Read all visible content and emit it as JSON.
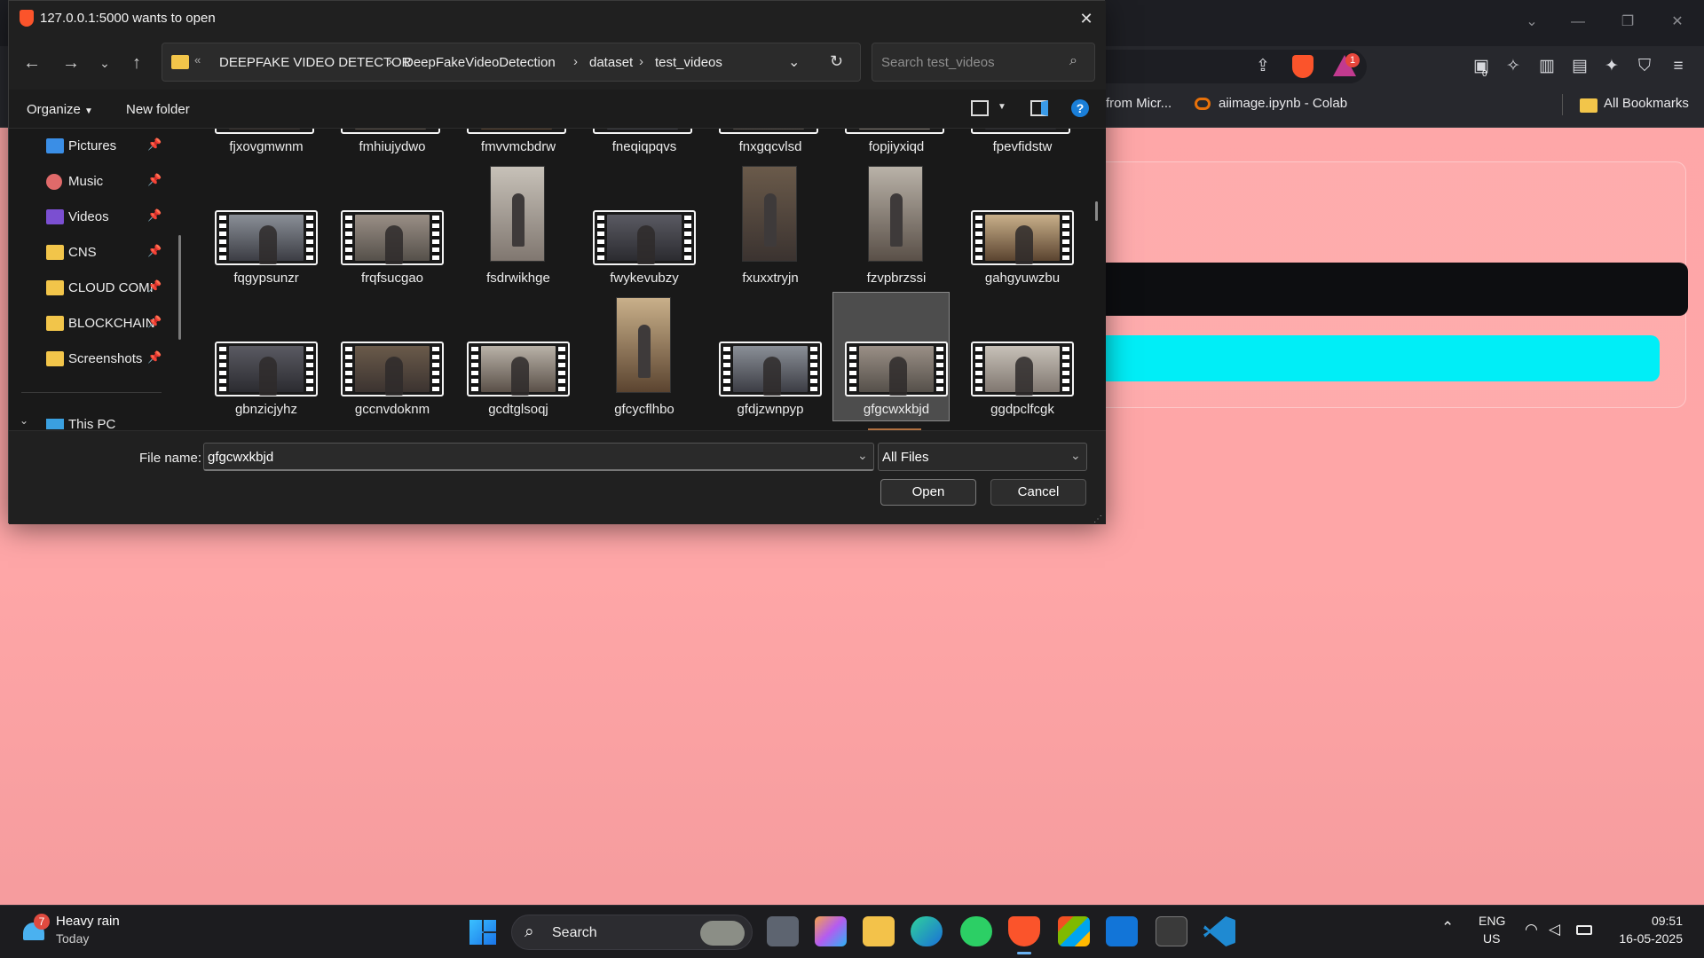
{
  "browser": {
    "bookmarks": [
      {
        "label": "from Micr..."
      },
      {
        "label": "aiimage.ipynb - Colab"
      },
      {
        "label": "All Bookmarks"
      }
    ],
    "notification_count": "1",
    "extension_badge": "0"
  },
  "dialog": {
    "title": "127.0.0.1:5000 wants to open",
    "breadcrumb": [
      "DEEPFAKE VIDEO DETECTOR",
      "DeepFakeVideoDetection",
      "dataset",
      "test_videos"
    ],
    "search_placeholder": "Search test_videos",
    "organize_label": "Organize",
    "new_folder_label": "New folder",
    "nav_pane": [
      {
        "label": "Pictures"
      },
      {
        "label": "Music"
      },
      {
        "label": "Videos"
      },
      {
        "label": "CNS"
      },
      {
        "label": "CLOUD COMI"
      },
      {
        "label": "BLOCKCHAIN"
      },
      {
        "label": "Screenshots"
      },
      {
        "label": "This PC"
      }
    ],
    "files_row1": [
      "fjxovgmwnm",
      "fmhiujydwo",
      "fmvvmcbdrw",
      "fneqiqpqvs",
      "fnxgqcvlsd",
      "fopjiyxiqd",
      "fpevfidstw"
    ],
    "files_row2": [
      "fqgypsunzr",
      "frqfsucgao",
      "fsdrwikhge",
      "fwykevubzy",
      "fxuxxtryjn",
      "fzvpbrzssi",
      "gahgyuwzbu"
    ],
    "files_row3": [
      "gbnzicjyhz",
      "gccnvdoknm",
      "gcdtglsoqj",
      "gfcycflhbo",
      "gfdjzwnpyp",
      "gfgcwxkbjd",
      "ggdpclfcgk"
    ],
    "selected_file": "gfgcwxkbjd",
    "file_name_label": "File name:",
    "file_name_value": "gfgcwxkbjd",
    "file_type": "All Files",
    "open_label": "Open",
    "cancel_label": "Cancel"
  },
  "taskbar": {
    "weather_title": "Heavy rain",
    "weather_sub": "Today",
    "weather_badge": "7",
    "search_label": "Search",
    "lang_top": "ENG",
    "lang_bottom": "US",
    "time": "09:51",
    "date": "16-05-2025"
  },
  "colors": {
    "page_bg": "#fea7a8",
    "cyan_bar": "#00eef7",
    "dialog_bg": "#202020",
    "accent": "#0078d4"
  }
}
